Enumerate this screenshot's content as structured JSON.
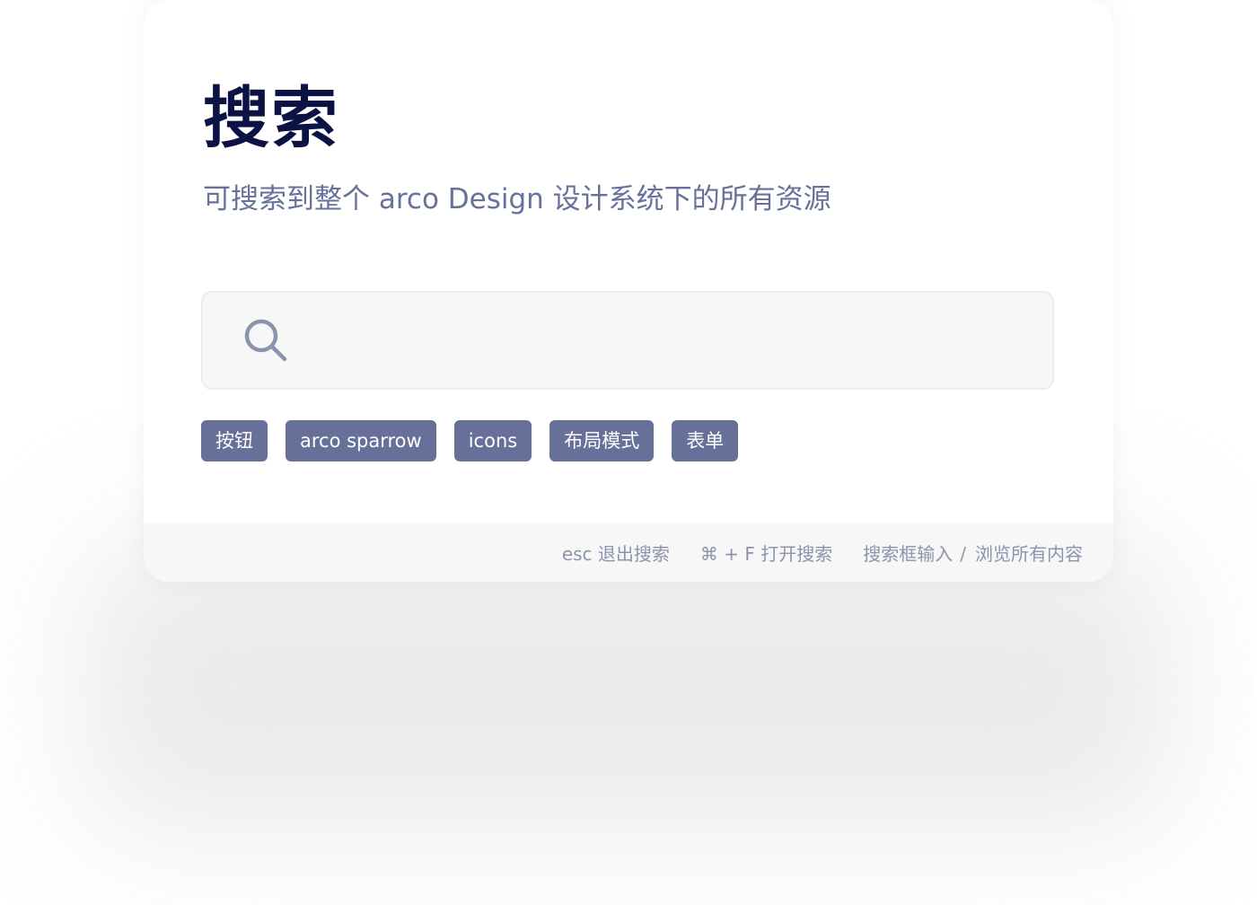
{
  "header": {
    "title": "搜索",
    "subtitle": "可搜索到整个 arco Design 设计系统下的所有资源"
  },
  "search": {
    "placeholder": "",
    "value": "",
    "icon": "search-icon"
  },
  "tags": [
    {
      "label": "按钮"
    },
    {
      "label": "arco sparrow"
    },
    {
      "label": "icons"
    },
    {
      "label": "布局模式"
    },
    {
      "label": "表单"
    }
  ],
  "footer": {
    "hints": [
      {
        "key": "esc",
        "action": "退出搜索"
      },
      {
        "key": "⌘ + F",
        "action": "打开搜索"
      },
      {
        "key": "搜索框输入",
        "separator": "/",
        "action": "浏览所有内容"
      }
    ]
  },
  "colors": {
    "title": "#0b1244",
    "subtitle": "#67719a",
    "tag_bg": "#667098",
    "footer_text": "#8d93ad",
    "input_bg": "#f7f7f7"
  }
}
